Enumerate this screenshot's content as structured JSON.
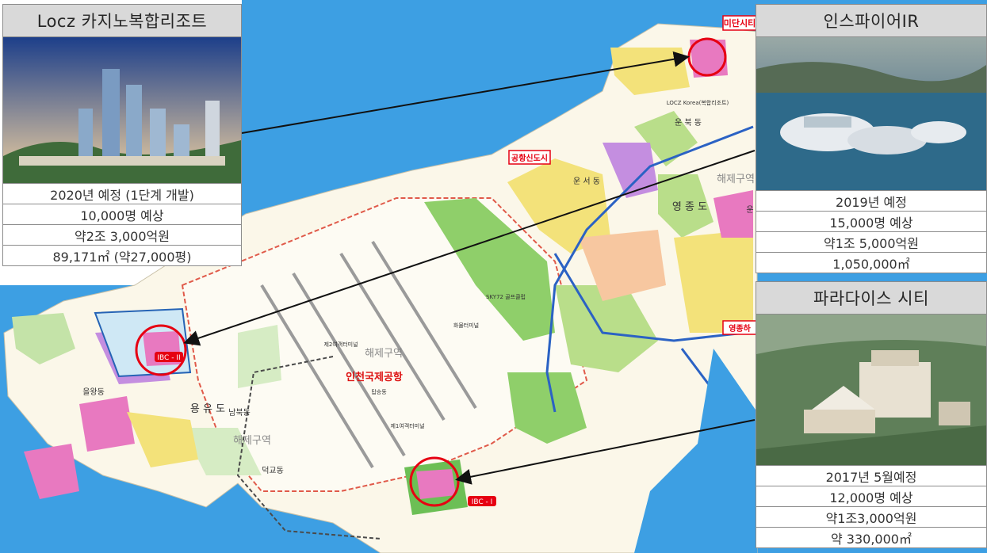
{
  "cards": {
    "locz": {
      "title": "Locz 카지노복합리조트",
      "rows": [
        "2020년 예정 (1단계 개발)",
        "10,000명 예상",
        "약2조 3,000억원",
        "89,171㎡ (약27,000평)"
      ]
    },
    "inspire": {
      "title": "인스파이어IR",
      "rows": [
        "2019년 예정",
        "15,000명 예상",
        "약1조 5,000억원",
        "1,050,000㎡"
      ]
    },
    "paradise": {
      "title": "파라다이스 시티",
      "rows": [
        "2017년 5월예정",
        "12,000명 예상",
        "약1조3,000억원",
        "약 330,000㎡"
      ]
    }
  },
  "map": {
    "labels": {
      "airport": "인천국제공항",
      "haeje_center": "해제구역",
      "haeje_south": "해제구역",
      "haeje_ne": "해제구역",
      "yeongjong": "영 종 도",
      "yongyu": "용 유 도",
      "eulwang": "을왕동",
      "namburk": "남북동",
      "deokgyo": "덕교동",
      "unseo": "운 서 동",
      "unbuk": "운 북 동",
      "ibc1": "IBC - I",
      "ibc2": "IBC - II",
      "terminal2": "제2여객터미널",
      "terminal1": "제1여객터미널",
      "cargo": "화물터미널",
      "skyfz": "SKY72 골프클럽",
      "airport_newcity_tag": "공항신도시",
      "midan_tag": "미단시티",
      "yeongjong_tag": "영종하",
      "un_tag": "운",
      "locz_korea": "LOCZ Korea(복합리조트)",
      "tower": "탑승동"
    },
    "colors": {
      "sea": "#3d9fe3",
      "land": "#fbf7e9",
      "green": "#8fcf6a",
      "pink": "#e879c0",
      "red_marker": "#e60012"
    }
  }
}
